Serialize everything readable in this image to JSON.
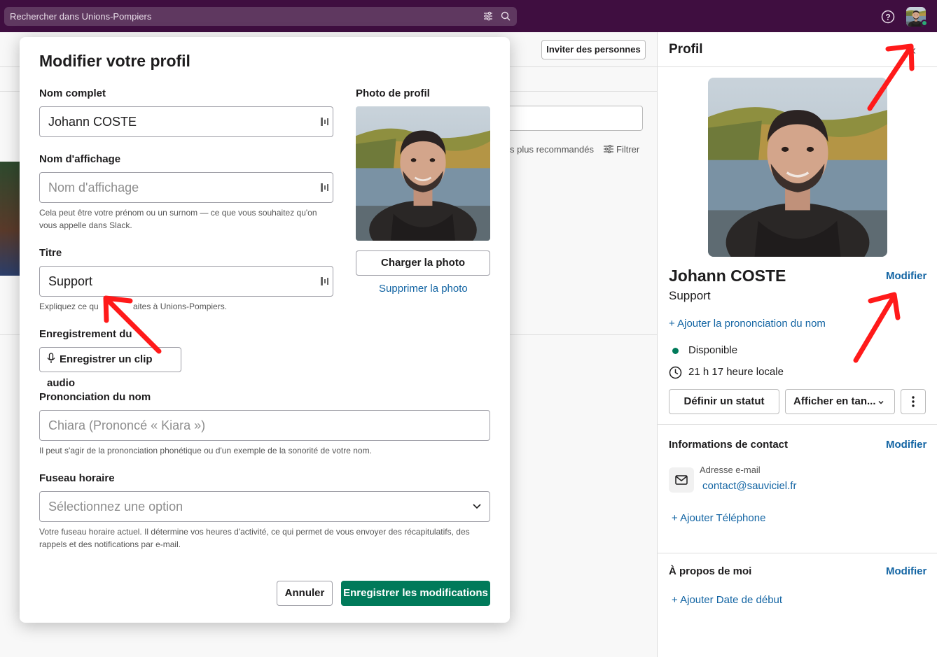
{
  "topbar": {
    "search_placeholder": "Rechercher dans Unions-Pompiers",
    "filter_icon": "sliders-icon",
    "search_icon": "search-icon",
    "help_icon": "help-icon",
    "status_color": "#2bac76"
  },
  "background": {
    "invite_label": "Inviter des personnes",
    "reco_text": "s plus recommandés",
    "filter_label": "Filtrer"
  },
  "profile_panel": {
    "title": "Profil",
    "name": "Johann COSTE",
    "name_modify": "Modifier",
    "role": "Support",
    "add_pronunciation": "Ajouter la prononciation du nom",
    "availability": "Disponible",
    "local_time": "21 h 17 heure locale",
    "set_status_btn": "Définir un statut",
    "show_as_btn": "Afficher en tan...",
    "contact": {
      "title": "Informations de contact",
      "modify": "Modifier",
      "email_label": "Adresse e-mail",
      "email": "contact@sauviciel.fr",
      "add_phone": "Ajouter Téléphone"
    },
    "about": {
      "title": "À propos de moi",
      "modify": "Modifier",
      "add_start_date": "Ajouter Date de début"
    }
  },
  "modal": {
    "title": "Modifier votre profil",
    "full_name_label": "Nom complet",
    "full_name_value": "Johann COSTE",
    "display_name_label": "Nom d'affichage",
    "display_name_placeholder": "Nom d'affichage",
    "display_name_help": "Cela peut être votre prénom ou un surnom — ce que vous souhaitez qu'on vous appelle dans Slack.",
    "title_label": "Titre",
    "title_value": "Support",
    "title_help": "Expliquez ce qu",
    "title_help_end": "aites à Unions-Pompiers.",
    "recording_label": "Enregistrement du",
    "record_btn": "Enregistrer un clip audio",
    "pronunciation_label": "Prononciation du nom",
    "pronunciation_placeholder": "Chiara (Prononcé « Kiara »)",
    "pronunciation_help": "Il peut s'agir de la prononciation phonétique ou d'un exemple de la sonorité de votre nom.",
    "timezone_label": "Fuseau horaire",
    "timezone_placeholder": "Sélectionnez une option",
    "timezone_help": "Votre fuseau horaire actuel. Il détermine vos heures d'activité, ce qui permet de vous envoyer des récapitulatifs, des rappels et des notifications par e-mail.",
    "photo_label": "Photo de profil",
    "upload_photo": "Charger la photo",
    "delete_photo": "Supprimer la photo",
    "cancel": "Annuler",
    "save": "Enregistrer les modifications",
    "accent_color": "#007a5a",
    "link_color": "#1264a3"
  }
}
